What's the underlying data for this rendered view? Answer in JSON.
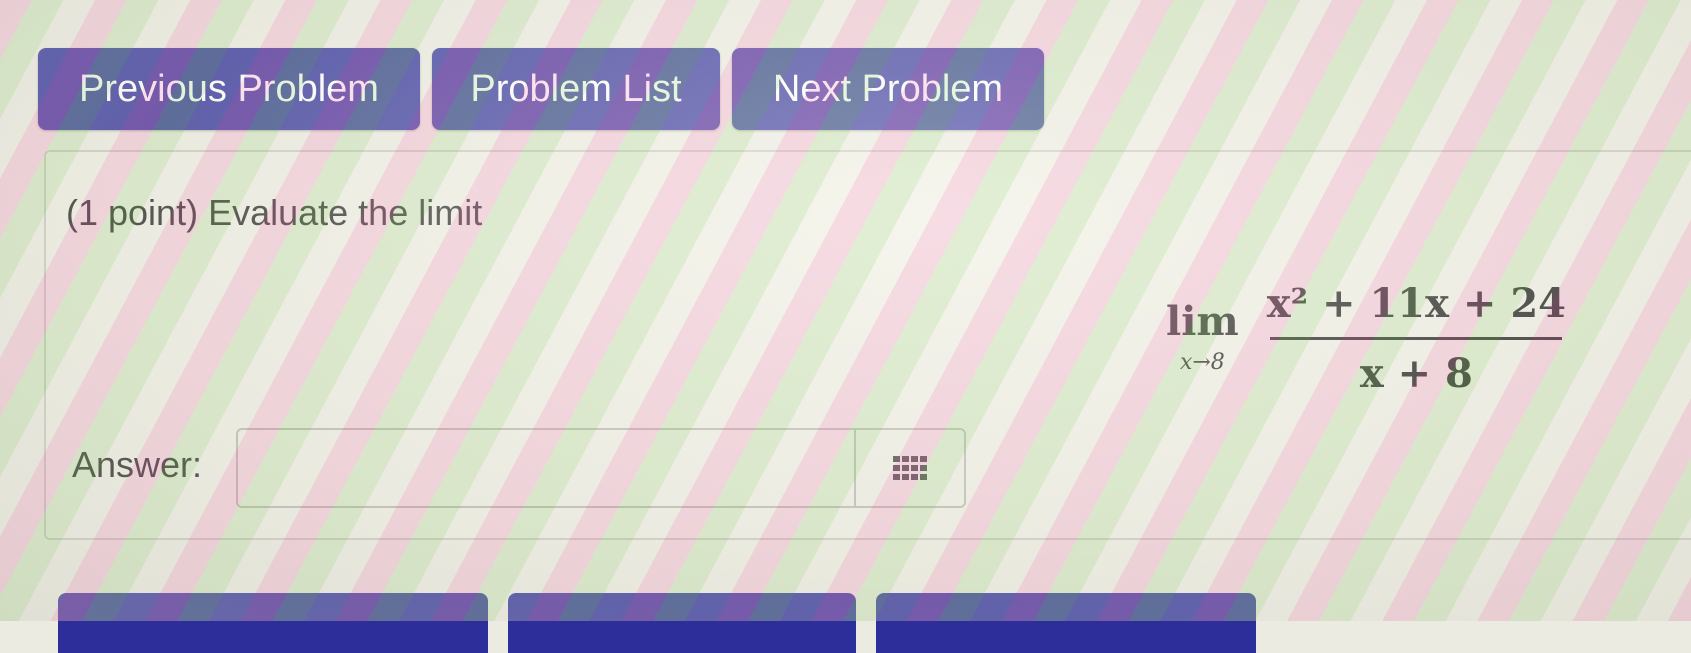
{
  "nav": {
    "previous_label": "Previous Problem",
    "list_label": "Problem List",
    "next_label": "Next Problem"
  },
  "problem": {
    "prompt": "(1 point) Evaluate the limit",
    "math": {
      "lim": "lim",
      "subscript": "x→8",
      "numerator": "x² + 11x + 24",
      "denominator": "x + 8"
    }
  },
  "answer": {
    "label": "Answer:",
    "value": "",
    "palette_icon": "grid-icon"
  },
  "bottom_buttons": [
    {
      "icon": "button-partially-visible"
    },
    {
      "icon": "button-partially-visible"
    },
    {
      "icon": "button-partially-visible"
    }
  ],
  "colors": {
    "button_bg": "#2e2e9a",
    "button_text": "#ffffff"
  }
}
